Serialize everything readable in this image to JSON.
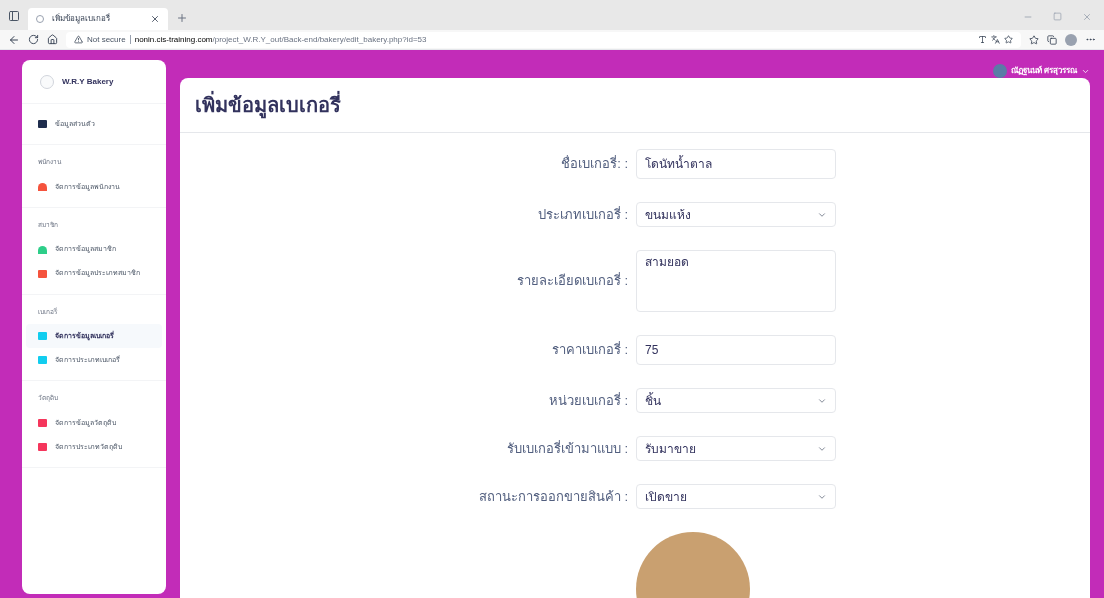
{
  "browser": {
    "tab_title": "เพิ่มข้อมูลเบเกอรี่",
    "security": "Not secure",
    "url_host": "nonin.cis-training.com",
    "url_path": "/project_W.R.Y_out/Back-end/bakery/edit_bakery.php?id=53"
  },
  "sidebar": {
    "brand": "W.R.Y Bakery",
    "sections": [
      {
        "items": [
          {
            "label": "ข้อมูลส่วนตัว",
            "selected": false,
            "color": "#1f2d4d"
          }
        ]
      },
      {
        "heading": "พนักงาน",
        "items": [
          {
            "label": "จัดการข้อมูลพนักงาน",
            "selected": false,
            "color": "#f5533d"
          }
        ]
      },
      {
        "heading": "สมาชิก",
        "items": [
          {
            "label": "จัดการข้อมูลสมาชิก",
            "selected": false,
            "color": "#2dce89"
          },
          {
            "label": "จัดการข้อมูลประเภทสมาชิก",
            "selected": false,
            "color": "#f5533d"
          }
        ]
      },
      {
        "heading": "เบเกอรี่",
        "items": [
          {
            "label": "จัดการข้อมูลเบเกอรี่",
            "selected": true,
            "color": "#11cdef"
          },
          {
            "label": "จัดการประเภทเบเกอรี่",
            "selected": false,
            "color": "#11cdef"
          }
        ]
      },
      {
        "heading": "วัตถุดิบ",
        "items": [
          {
            "label": "จัดการข้อมูลวัตถุดิบ",
            "selected": false,
            "color": "#f5365c"
          },
          {
            "label": "จัดการประเภทวัตถุดิบ",
            "selected": false,
            "color": "#f5365c"
          }
        ]
      }
    ]
  },
  "user": {
    "name": "ณัฏฐนนท์ ศรสุวรรณ"
  },
  "page_title": "เพิ่มข้อมูลเบเกอรี่",
  "form": [
    {
      "kind": "text",
      "label": "ชื่อเบเกอรี่: :",
      "value": "โดนัทน้ำตาล"
    },
    {
      "kind": "select",
      "label": "ประเภทเบเกอรี่ :",
      "value": "ขนมแห้ง"
    },
    {
      "kind": "textarea",
      "label": "รายละเอียดเบเกอรี่ :",
      "value": "สามยอด"
    },
    {
      "kind": "text",
      "label": "ราคาเบเกอรี่ :",
      "value": "75"
    },
    {
      "kind": "select",
      "label": "หน่วยเบเกอรี่ :",
      "value": "ชิ้น"
    },
    {
      "kind": "select",
      "label": "รับเบเกอรี่เข้ามาแบบ :",
      "value": "รับมาขาย"
    },
    {
      "kind": "select",
      "label": "สถานะการออกขายสินค้า :",
      "value": "เปิดขาย"
    }
  ]
}
